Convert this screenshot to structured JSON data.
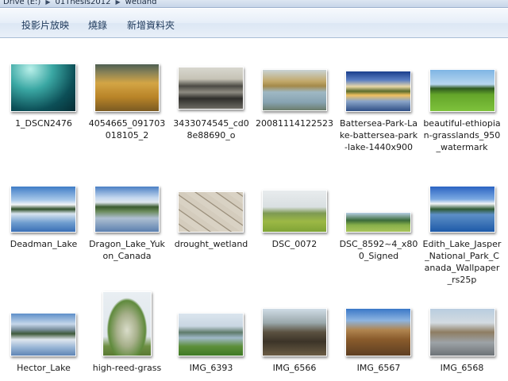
{
  "address": {
    "crumbs": [
      "Drive (E:)",
      "01Thesis2012",
      "wetland"
    ]
  },
  "toolbar": {
    "slideshow": "投影片放映",
    "burn": "燒錄",
    "new_folder": "新增資料夾"
  },
  "items": [
    {
      "name": "1_DSCN2476",
      "thumb": "underwater-light"
    },
    {
      "name": "4054665_091703018105_2",
      "thumb": "golden-reeds"
    },
    {
      "name": "3433074545_cd08e88690_o",
      "thumb": "dark-mudflat"
    },
    {
      "name": "20081114122523",
      "thumb": "marsh-water"
    },
    {
      "name": "Battersea-Park-Lake-battersea-park-lake-1440x900",
      "thumb": "lake-trees-sunset"
    },
    {
      "name": "beautiful-ethiopian-grasslands_950_watermark",
      "thumb": "green-grassland"
    },
    {
      "name": "Deadman_Lake",
      "thumb": "lake-reflection"
    },
    {
      "name": "Dragon_Lake_Yukon_Canada",
      "thumb": "lake-forest"
    },
    {
      "name": "drought_wetland",
      "thumb": "cracked-earth"
    },
    {
      "name": "DSC_0072",
      "thumb": "green-field"
    },
    {
      "name": "DSC_8592~4_x800_Signed",
      "thumb": "hill-meadow"
    },
    {
      "name": "Edith_Lake_Jasper_National_Park_Canada_Wallpaper_rs25p",
      "thumb": "blue-lake"
    },
    {
      "name": "Hector_Lake",
      "thumb": "mountain-lake"
    },
    {
      "name": "high-reed-grass",
      "thumb": "reed-plume"
    },
    {
      "name": "IMG_6393",
      "thumb": "wetland-water"
    },
    {
      "name": "IMG_6566",
      "thumb": "dry-trees"
    },
    {
      "name": "IMG_6567",
      "thumb": "brown-shrubs"
    },
    {
      "name": "IMG_6568",
      "thumb": "path-trees"
    }
  ]
}
